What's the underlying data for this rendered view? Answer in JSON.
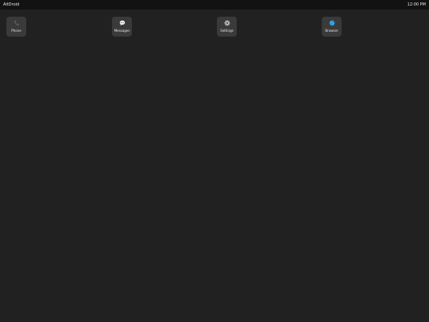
{
  "status_bar": {
    "app_name": "AitDroid",
    "time": "12:00 PM"
  },
  "apps": [
    {
      "label": "Phone",
      "icon": "phone-icon"
    },
    {
      "label": "Messages",
      "icon": "speech-bubble-icon"
    },
    {
      "label": "Settings",
      "icon": "gear-icon"
    },
    {
      "label": "Browser",
      "icon": "globe-icon"
    }
  ],
  "colors": {
    "background": "#212121",
    "status_bar": "#121212",
    "tile": "#3a3a3a",
    "globe": "#2f8fe8",
    "gear": "#b9c3cc"
  }
}
